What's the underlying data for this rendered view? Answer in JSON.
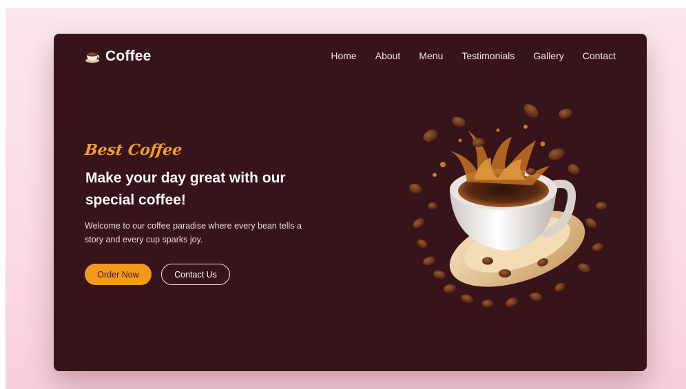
{
  "brand": {
    "name": "Coffee",
    "icon": "coffee-cup-icon",
    "accent_color": "#f39a1d",
    "card_color": "#37131a"
  },
  "nav": {
    "items": [
      {
        "label": "Home"
      },
      {
        "label": "About"
      },
      {
        "label": "Menu"
      },
      {
        "label": "Testimonials"
      },
      {
        "label": "Gallery"
      },
      {
        "label": "Contact"
      }
    ]
  },
  "hero": {
    "tagline": "Best Coffee",
    "headline": "Make your day great with our special coffee!",
    "description": "Welcome to our coffee paradise where every bean tells a story and every cup sparks joy.",
    "primary_button": "Order Now",
    "secondary_button": "Contact Us",
    "image": "coffee-splash-cup-illustration"
  }
}
